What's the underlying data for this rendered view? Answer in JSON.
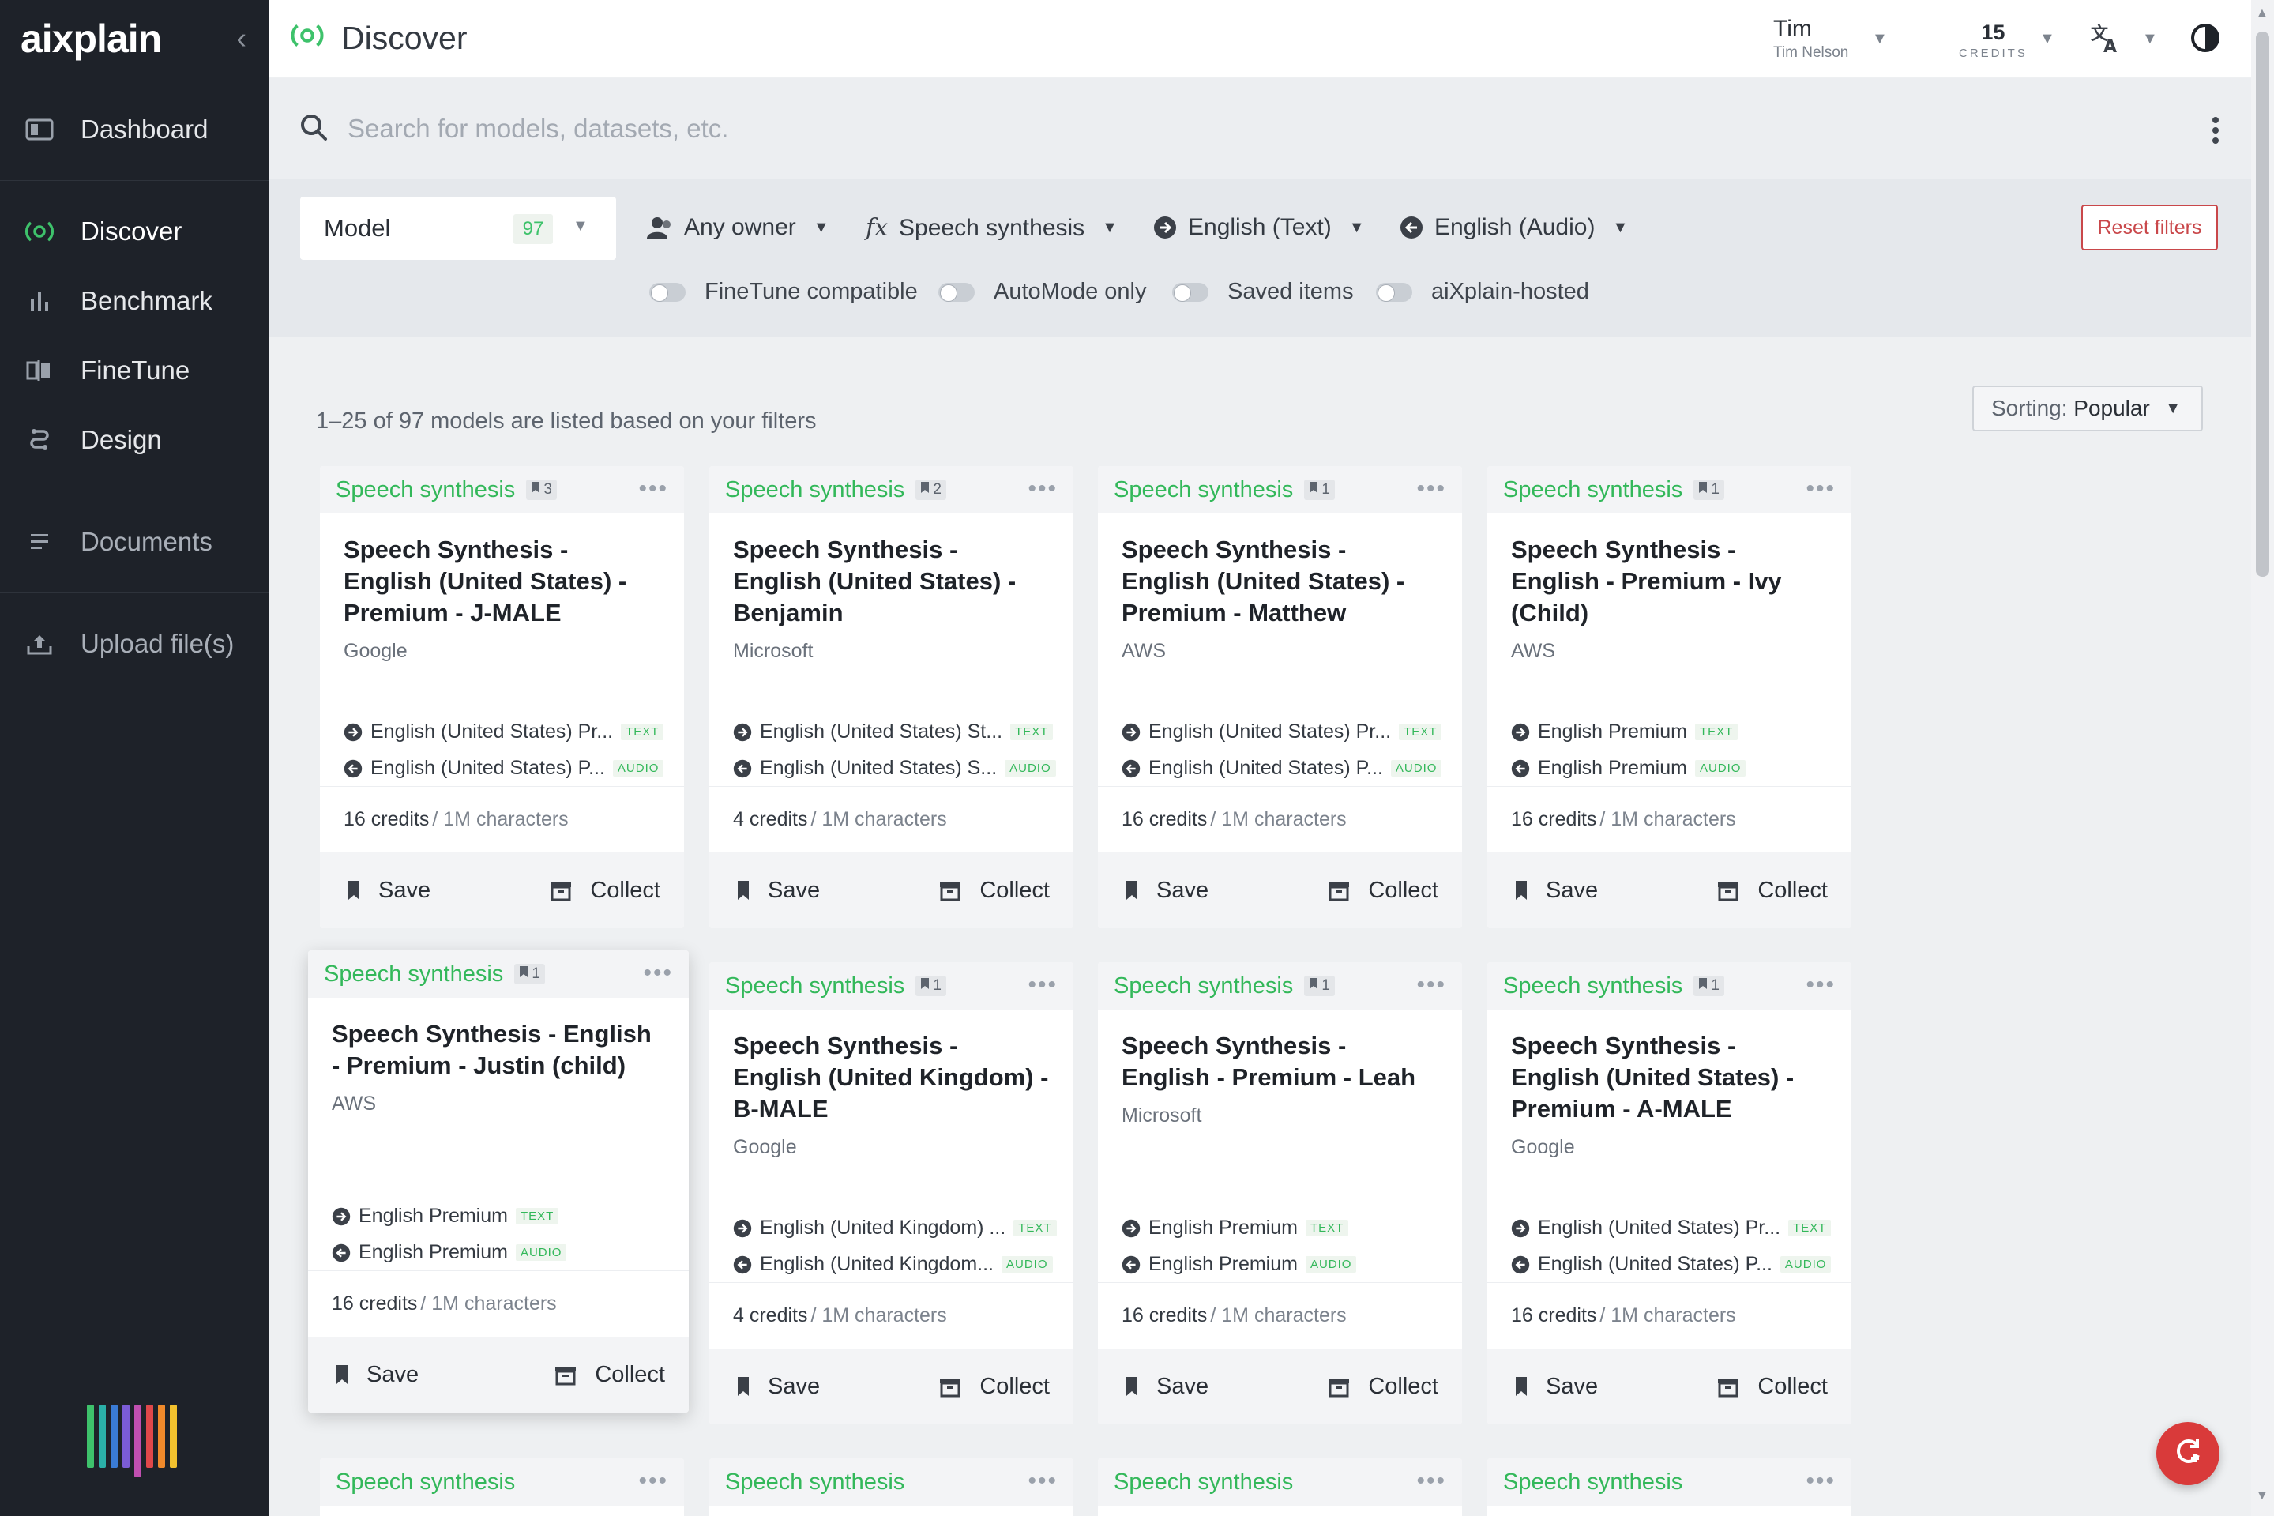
{
  "app": {
    "logo": "aixplain",
    "page_title": "Discover"
  },
  "sidebar": {
    "items": [
      {
        "label": "Dashboard",
        "icon": "dashboard-icon"
      },
      {
        "label": "Discover",
        "icon": "discover-icon",
        "active": true
      },
      {
        "label": "Benchmark",
        "icon": "benchmark-icon"
      },
      {
        "label": "FineTune",
        "icon": "finetune-icon"
      },
      {
        "label": "Design",
        "icon": "design-icon"
      },
      {
        "label": "Documents",
        "icon": "documents-icon"
      },
      {
        "label": "Upload file(s)",
        "icon": "upload-icon"
      }
    ],
    "stripe_colors": [
      "#3ec26b",
      "#2bb0a8",
      "#3a7bd5",
      "#7b5cd6",
      "#c04fb0",
      "#e0484a",
      "#f08a2b",
      "#f2c12e"
    ]
  },
  "header": {
    "user_name": "Tim",
    "user_full": "Tim Nelson",
    "credits_value": "15",
    "credits_label": "CREDITS"
  },
  "search": {
    "placeholder": "Search for models, datasets, etc."
  },
  "filters": {
    "type": {
      "label": "Model",
      "count": "97"
    },
    "owner": "Any owner",
    "function": "Speech synthesis",
    "input_lang": "English (Text)",
    "output_lang": "English (Audio)",
    "reset": "Reset filters",
    "toggles": [
      "FineTune compatible",
      "AutoMode only",
      "Saved items",
      "aiXplain-hosted"
    ]
  },
  "results": {
    "summary": "1–25 of 97 models are listed based on your filters",
    "sort_label": "Sorting:",
    "sort_value": "Popular"
  },
  "card_labels": {
    "save": "Save",
    "collect": "Collect",
    "text_tag": "TEXT",
    "audio_tag": "AUDIO",
    "unit": "/ 1M characters"
  },
  "cards": [
    {
      "function": "Speech synthesis",
      "saves": "3",
      "title": "Speech Synthesis - English (United States) - Premium - J-MALE",
      "owner": "Google",
      "input": "English (United States) Pr...",
      "output": "English (United States) P...",
      "credits": "16 credits"
    },
    {
      "function": "Speech synthesis",
      "saves": "2",
      "title": "Speech Synthesis - English (United States) - Benjamin",
      "owner": "Microsoft",
      "input": "English (United States) St...",
      "output": "English (United States) S...",
      "credits": "4 credits"
    },
    {
      "function": "Speech synthesis",
      "saves": "1",
      "title": "Speech Synthesis - English (United States) - Premium - Matthew",
      "owner": "AWS",
      "input": "English (United States) Pr...",
      "output": "English (United States) P...",
      "credits": "16 credits"
    },
    {
      "function": "Speech synthesis",
      "saves": "1",
      "title": "Speech Synthesis - English - Premium - Ivy (Child)",
      "owner": "AWS",
      "input": "English Premium",
      "output": "English Premium",
      "credits": "16 credits"
    },
    {
      "function": "Speech synthesis",
      "saves": "1",
      "title": "Speech Synthesis - English - Premium - Justin (child)",
      "owner": "AWS",
      "input": "English Premium",
      "output": "English Premium",
      "credits": "16 credits"
    },
    {
      "function": "Speech synthesis",
      "saves": "1",
      "title": "Speech Synthesis - English (United Kingdom) - B-MALE",
      "owner": "Google",
      "input": "English (United Kingdom) ...",
      "output": "English (United Kingdom...",
      "credits": "4 credits"
    },
    {
      "function": "Speech synthesis",
      "saves": "1",
      "title": "Speech Synthesis - English - Premium - Leah",
      "owner": "Microsoft",
      "input": "English Premium",
      "output": "English Premium",
      "credits": "16 credits"
    },
    {
      "function": "Speech synthesis",
      "saves": "1",
      "title": "Speech Synthesis - English (United States) - Premium - A-MALE",
      "owner": "Google",
      "input": "English (United States) Pr...",
      "output": "English (United States) P...",
      "credits": "16 credits"
    },
    {
      "function": "Speech synthesis"
    },
    {
      "function": "Speech synthesis"
    },
    {
      "function": "Speech synthesis"
    },
    {
      "function": "Speech synthesis"
    }
  ]
}
